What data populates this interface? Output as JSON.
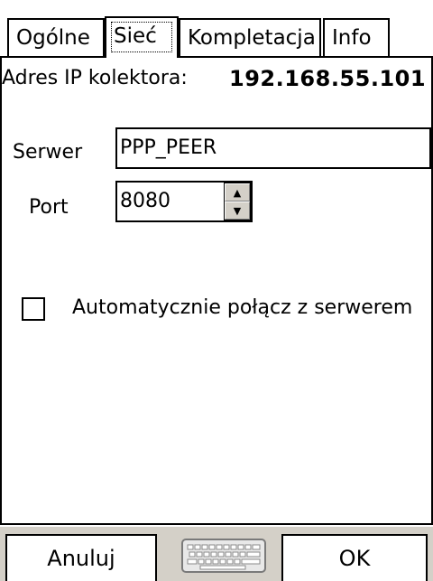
{
  "tabs": [
    {
      "label": "Ogólne"
    },
    {
      "label": "Sieć"
    },
    {
      "label": "Kompletacja"
    },
    {
      "label": "Info"
    }
  ],
  "network": {
    "ip_label": "Adres IP kolektora:",
    "ip_value": "192.168.55.101",
    "server_label": "Serwer",
    "server_value": "PPP_PEER",
    "port_label": "Port",
    "port_value": "8080",
    "auto_connect_label": "Automatycznie połącz z serwerem",
    "auto_connect_checked": false
  },
  "bottom": {
    "cancel_label": "Anuluj",
    "ok_label": "OK",
    "keyboard_icon": "keyboard-icon"
  }
}
